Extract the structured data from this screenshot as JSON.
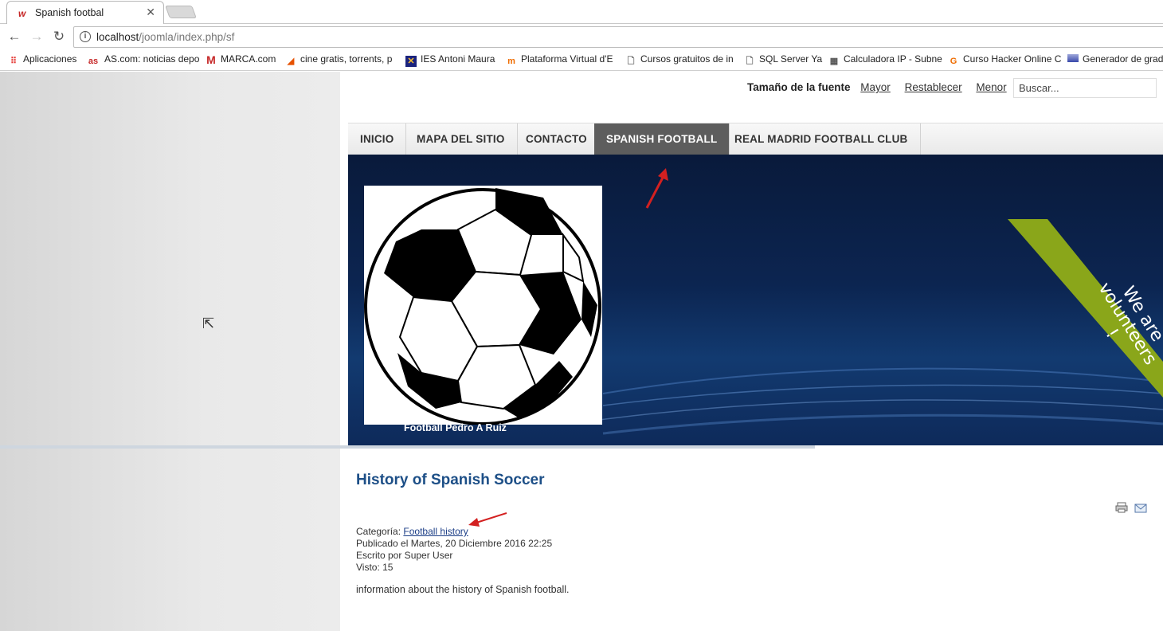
{
  "browser": {
    "tab_title": "Spanish footbal",
    "tab_favicon": "w",
    "url_host": "localhost",
    "url_path": "/joomla/index.php/sf",
    "bookmarks": [
      {
        "label": "Aplicaciones",
        "icon": "apps-grid-icon"
      },
      {
        "label": "AS.com: noticias depo",
        "icon": "as-logo-icon"
      },
      {
        "label": "MARCA.com",
        "icon": "marca-logo-icon"
      },
      {
        "label": "cine gratis, torrents, p",
        "icon": "film-icon"
      },
      {
        "label": "IES Antoni Maura",
        "icon": "ies-logo-icon"
      },
      {
        "label": "Plataforma Virtual d'E",
        "icon": "moodle-icon"
      },
      {
        "label": "Cursos gratuitos de in",
        "icon": "page-icon"
      },
      {
        "label": "SQL Server Ya",
        "icon": "page-icon"
      },
      {
        "label": "Calculadora IP - Subne",
        "icon": "calculator-icon"
      },
      {
        "label": "Curso Hacker Online C",
        "icon": "hacker-icon"
      },
      {
        "label": "Generador de grad",
        "icon": "gradient-icon"
      }
    ]
  },
  "top": {
    "font_size_label": "Tamaño de la fuente",
    "bigger": "Mayor",
    "reset": "Restablecer",
    "smaller": "Menor",
    "search_value": "Buscar..."
  },
  "menu": {
    "items": [
      {
        "label": "INICIO"
      },
      {
        "label": "MAPA DEL SITIO"
      },
      {
        "label": "CONTACTO"
      },
      {
        "label": "SPANISH FOOTBALL"
      },
      {
        "label": "REAL MADRID FOOTBALL CLUB"
      }
    ]
  },
  "header": {
    "image_caption": "Football Pedro A Ruiz",
    "ribbon_line1": "We are",
    "ribbon_line2": "volunteers !"
  },
  "article": {
    "title": "History of Spanish Soccer",
    "category_label": "Categoría:",
    "category_link": "Football history",
    "published": "Publicado el Martes, 20 Diciembre 2016 22:25",
    "author": "Escrito por Super User",
    "views": "Visto: 15",
    "body": "information about the history of Spanish football."
  },
  "colors": {
    "title": "#1d4f87",
    "active_menu": "#5d5d5d",
    "ribbon": "#8aa61a",
    "annotation_arrow": "#d32020"
  }
}
